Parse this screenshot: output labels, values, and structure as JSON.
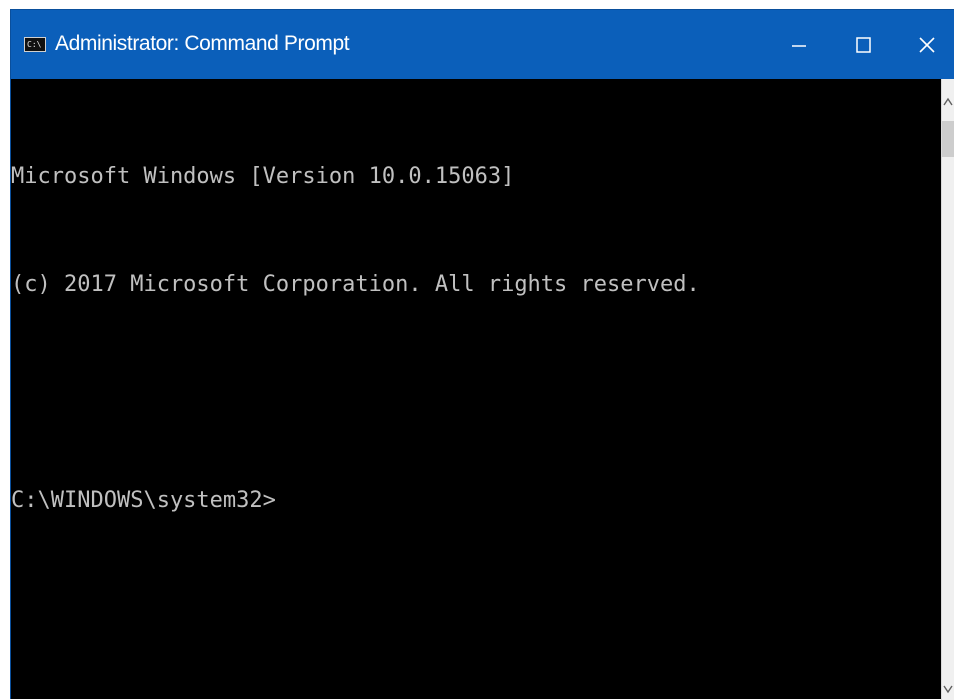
{
  "window": {
    "title": "Administrator: Command Prompt",
    "app_icon_text": "C:\\",
    "controls": {
      "minimize": "minimize",
      "maximize": "maximize",
      "close": "close"
    },
    "colors": {
      "titlebar": "#0b5fba",
      "console_background": "#000000",
      "console_text": "#c0c0c0"
    }
  },
  "console": {
    "lines": [
      "Microsoft Windows [Version 10.0.15063]",
      "(c) 2017 Microsoft Corporation. All rights reserved.",
      "",
      "C:\\WINDOWS\\system32>"
    ]
  },
  "scrollbar": {
    "up_icon": "chevron-up-icon",
    "down_icon": "chevron-down-icon"
  }
}
